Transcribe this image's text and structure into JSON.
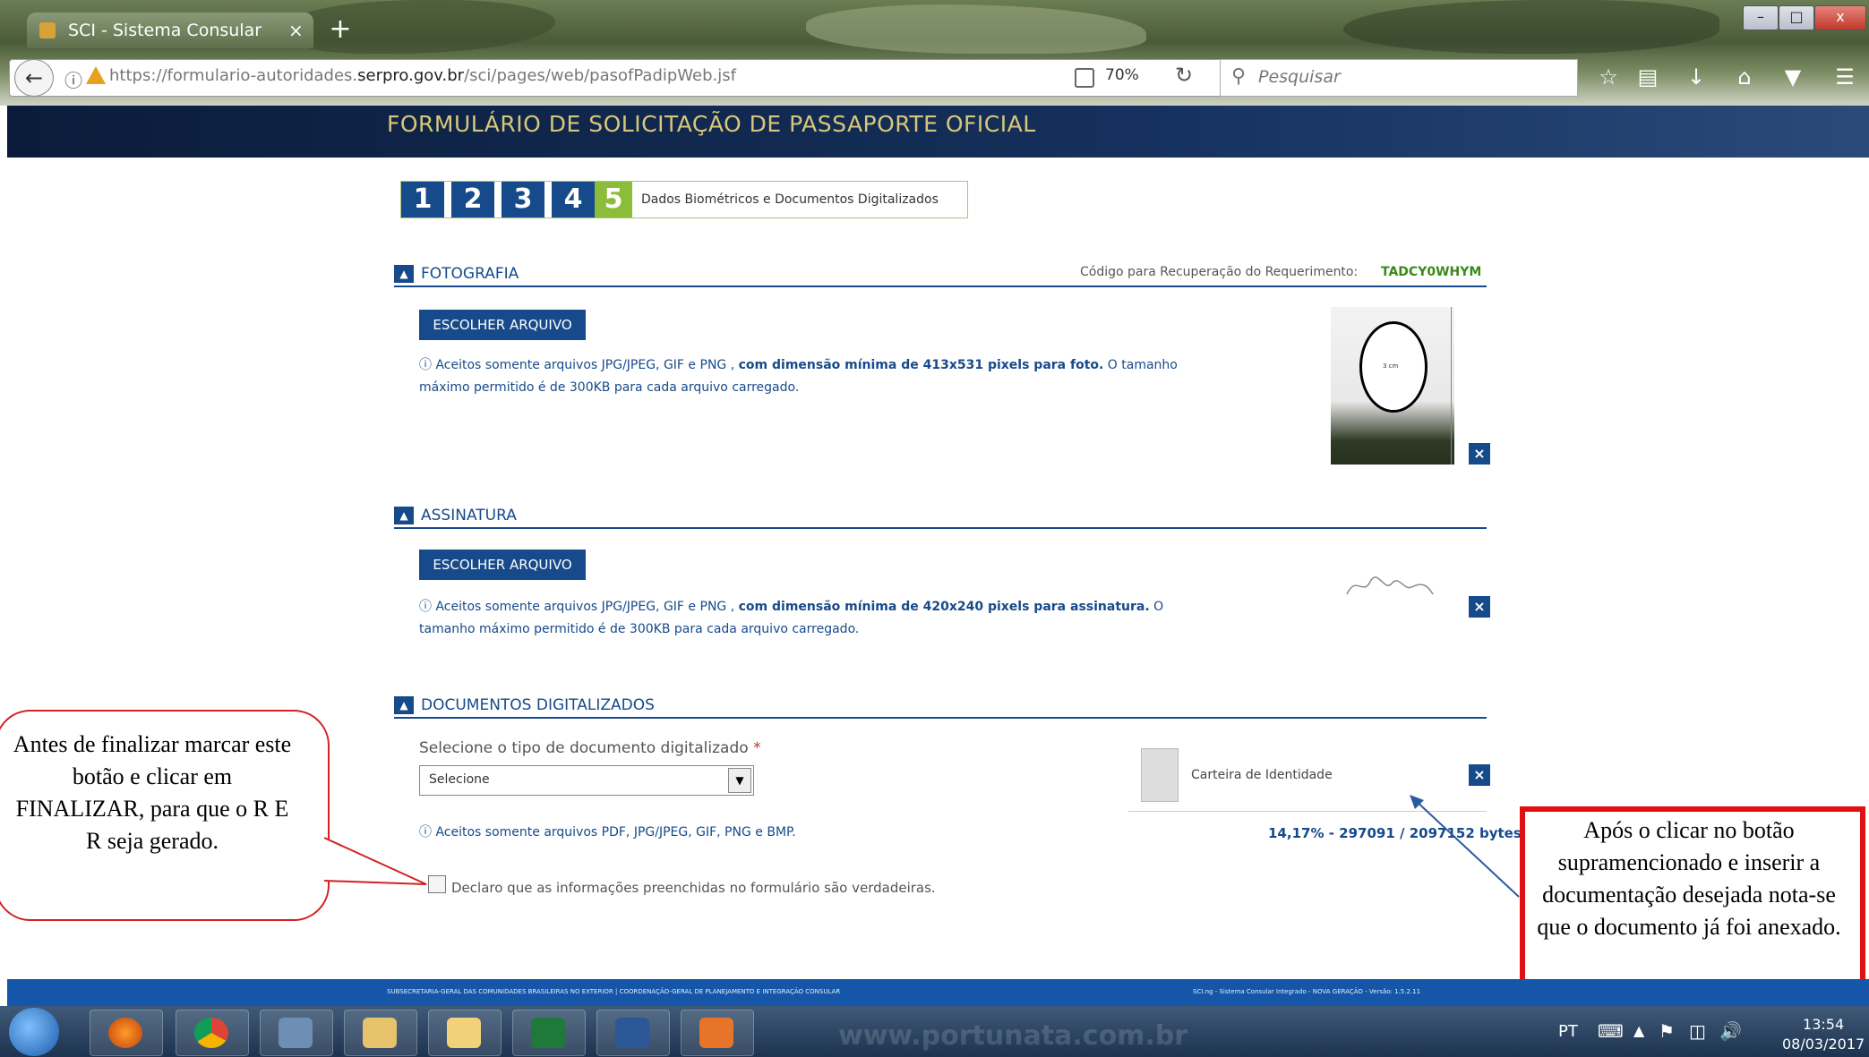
{
  "browser": {
    "tab_title": "SCI - Sistema Consular Inte...",
    "tab_close": "×",
    "new_tab": "+",
    "url_prefix": "https://formulario-autoridades.",
    "url_domain": "serpro.gov.br",
    "url_path": "/sci/pages/web/pasofPadipWeb.jsf",
    "zoom": "70%",
    "search_placeholder": "Pesquisar",
    "window_min": "–",
    "window_max": "□",
    "window_close": "x"
  },
  "page": {
    "title": "FORMULÁRIO DE SOLICITAÇÃO DE PASSAPORTE OFICIAL",
    "steps": [
      "1",
      "2",
      "3",
      "4",
      "5"
    ],
    "active_step": 5,
    "step_label": "Dados Biométricos e Documentos Digitalizados"
  },
  "photo_section": {
    "title": "FOTOGRAFIA",
    "recovery_label": "Código para Recuperação do Requerimento:",
    "recovery_code": "TADCY0WHYM",
    "button": "ESCOLHER ARQUIVO",
    "info_prefix": "Aceitos somente arquivos JPG/JPEG, GIF e PNG ,",
    "info_bold": "com dimensão mínima de 413x531 pixels para foto.",
    "info_suffix": "O tamanho",
    "info_line2": "máximo permitido é de 300KB para cada arquivo carregado.",
    "photo_label": "3 cm"
  },
  "signature_section": {
    "title": "ASSINATURA",
    "button": "ESCOLHER ARQUIVO",
    "info_prefix": "Aceitos somente arquivos JPG/JPEG, GIF e PNG ,",
    "info_bold": "com dimensão mínima de 420x240 pixels para assinatura.",
    "info_suffix": "O",
    "info_line2": "tamanho máximo permitido é de 300KB para cada arquivo carregado."
  },
  "documents_section": {
    "title": "DOCUMENTOS DIGITALIZADOS",
    "select_label": "Selecione o tipo de documento digitalizado",
    "required_mark": "*",
    "select_value": "Selecione",
    "doc_name": "Carteira de Identidade",
    "info": "Aceitos somente arquivos PDF, JPG/JPEG, GIF, PNG e BMP.",
    "progress": "14,17% - 297091 / 2097152 bytes",
    "declaration": "Declaro que as informações preenchidas no formulário são verdadeiras.",
    "remove": "×"
  },
  "callouts": {
    "left": "Antes de finalizar marcar este botão e clicar em FINALIZAR, para que o R E R seja gerado.",
    "right": "Após o clicar no botão supramencionado e inserir a documentação desejada nota-se que o documento já foi anexado."
  },
  "footer": {
    "left": "SUBSECRETARIA-GERAL DAS COMUNIDADES BRASILEIRAS NO EXTERIOR | COORDENAÇÃO-GERAL DE PLANEJAMENTO E INTEGRAÇÃO CONSULAR",
    "right": "SCI.ng - Sistema Consular Integrado - NOVA GERAÇÃO - Versão: 1.5.2.11"
  },
  "taskbar": {
    "watermark": "www.portunata.com.br",
    "lang": "PT",
    "time": "13:54",
    "date": "08/03/2017"
  },
  "colors": {
    "brand_blue": "#164a8a",
    "step_active": "#8bbd3a",
    "recovery_code": "#3a8a1a",
    "callout_red": "#e01010"
  }
}
